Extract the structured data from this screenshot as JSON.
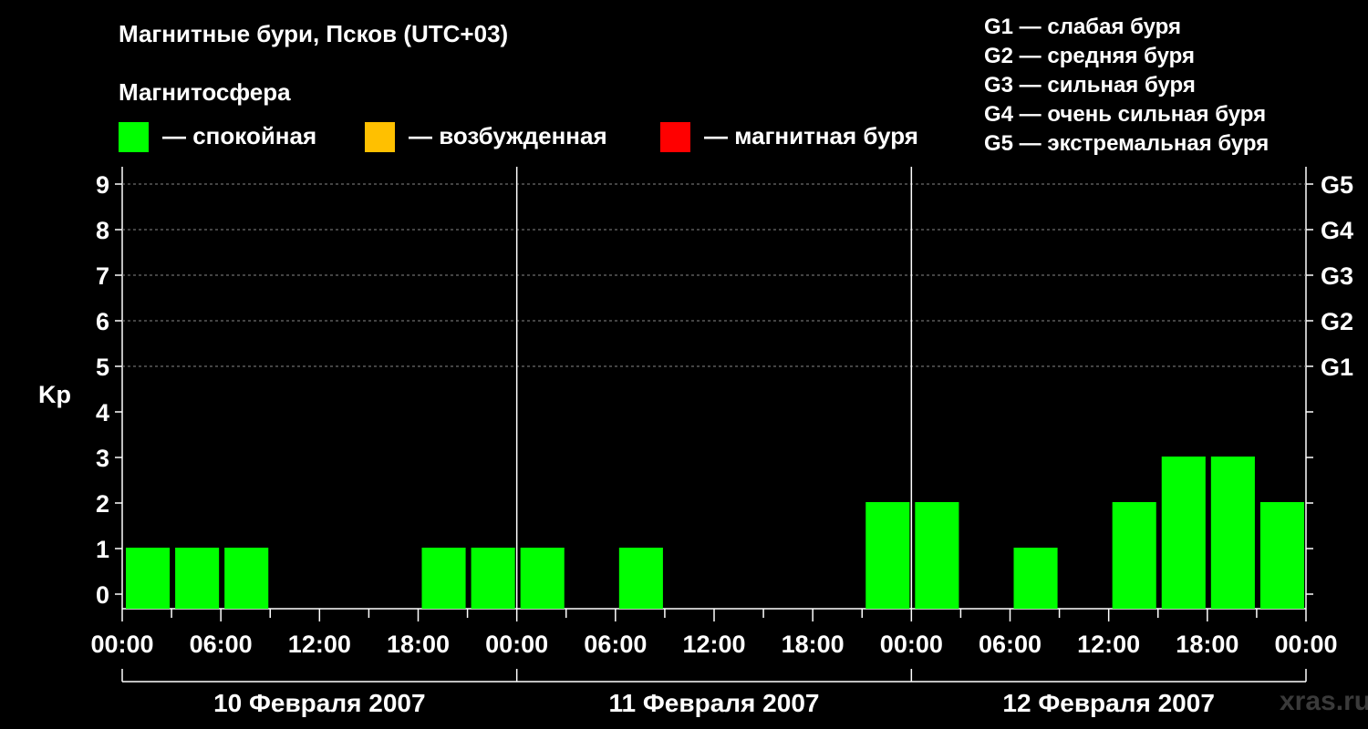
{
  "title": "Магнитные бури, Псков (UTC+03)",
  "magnetosphere_label": "Магнитосфера",
  "legend": [
    {
      "label": "— спокойная",
      "color": "#00ff00"
    },
    {
      "label": "— возбужденная",
      "color": "#ffc000"
    },
    {
      "label": "— магнитная буря",
      "color": "#ff0000"
    }
  ],
  "g_scale": [
    "G1 — слабая буря",
    "G2 — средняя буря",
    "G3 — сильная буря",
    "G4 — очень сильная буря",
    "G5 — экстремальная буря"
  ],
  "watermark": "xras.ru",
  "chart_data": {
    "type": "bar",
    "ylabel": "Kp",
    "ylim": [
      0,
      9
    ],
    "yticks": [
      "0",
      "1",
      "2",
      "3",
      "4",
      "5",
      "6",
      "7",
      "8",
      "9"
    ],
    "right_ticks": [
      {
        "kp": 5,
        "label": "G1"
      },
      {
        "kp": 6,
        "label": "G2"
      },
      {
        "kp": 7,
        "label": "G3"
      },
      {
        "kp": 8,
        "label": "G4"
      },
      {
        "kp": 9,
        "label": "G5"
      }
    ],
    "grid": "dashed horizontal at Kp 5–9",
    "xtick_labels": [
      "00:00",
      "06:00",
      "12:00",
      "18:00",
      "00:00",
      "06:00",
      "12:00",
      "18:00",
      "00:00",
      "06:00",
      "12:00",
      "18:00",
      "00:00"
    ],
    "days": [
      "10 Февраля 2007",
      "11 Февраля 2007",
      "12 Февраля 2007"
    ],
    "interval_hours": 3,
    "values": [
      1,
      1,
      1,
      0,
      0,
      0,
      1,
      1,
      1,
      0,
      1,
      0,
      0,
      0,
      0,
      2,
      2,
      0,
      1,
      0,
      2,
      3,
      3,
      2
    ],
    "color": "#00ff00"
  }
}
